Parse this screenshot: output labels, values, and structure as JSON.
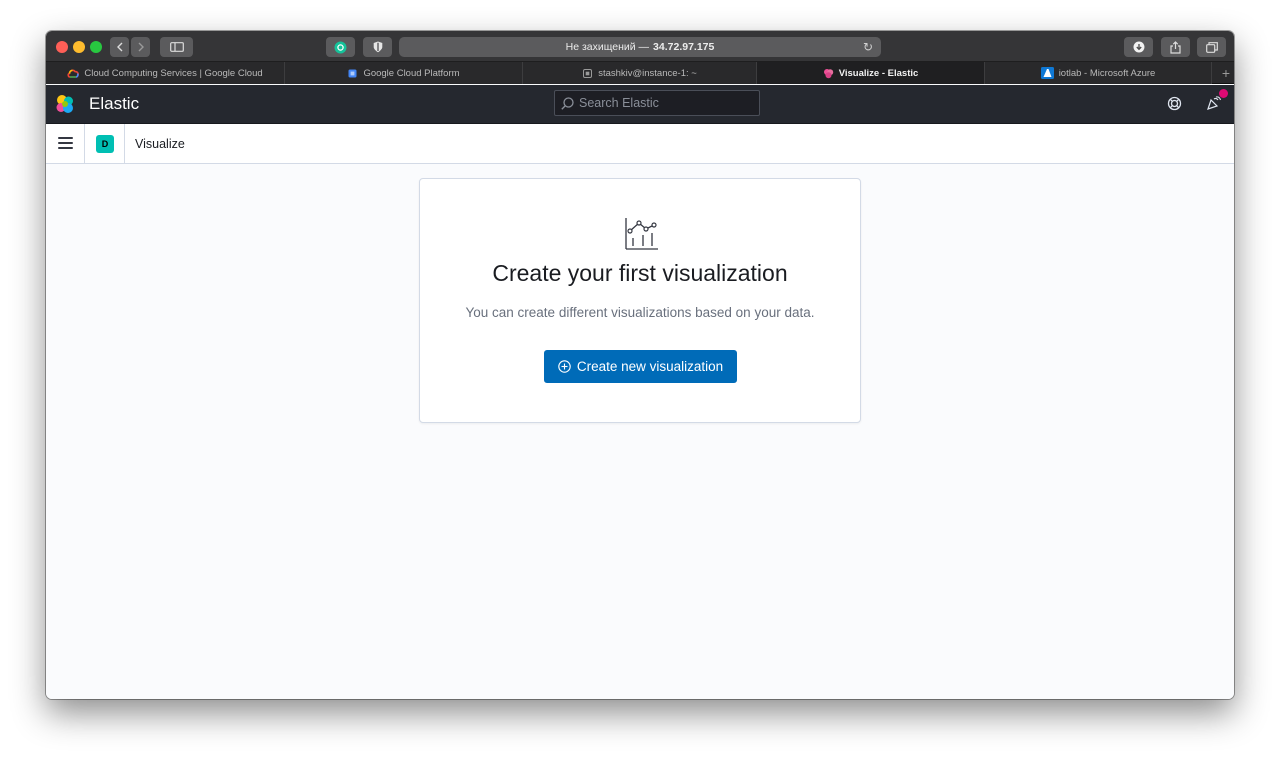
{
  "browser": {
    "address": {
      "prefix": "Не захищений —",
      "host": "34.72.97.175"
    },
    "tabs": [
      {
        "label": "Cloud Computing Services | Google Cloud",
        "icon": "google-cloud-icon",
        "active": false
      },
      {
        "label": "Google Cloud Platform",
        "icon": "gcp-chip-icon",
        "active": false
      },
      {
        "label": "stashkiv@instance-1: ~",
        "icon": "terminal-chip-icon",
        "active": false
      },
      {
        "label": "Visualize - Elastic",
        "icon": "elastic-icon",
        "active": true
      },
      {
        "label": "iotlab - Microsoft Azure",
        "icon": "azure-icon",
        "active": false
      }
    ],
    "new_tab": "+"
  },
  "header": {
    "brand": "Elastic",
    "search_placeholder": "Search Elastic"
  },
  "breadcrumb": {
    "space_initial": "D",
    "current": "Visualize"
  },
  "empty_state": {
    "title": "Create your first visualization",
    "body": "You can create different visualizations based on your data.",
    "button_label": "Create new visualization"
  },
  "colors": {
    "primary_button": "#006bb8",
    "space_badge": "#00bfb3",
    "notification_dot": "#dd0a73",
    "header_bg": "#25282f"
  }
}
